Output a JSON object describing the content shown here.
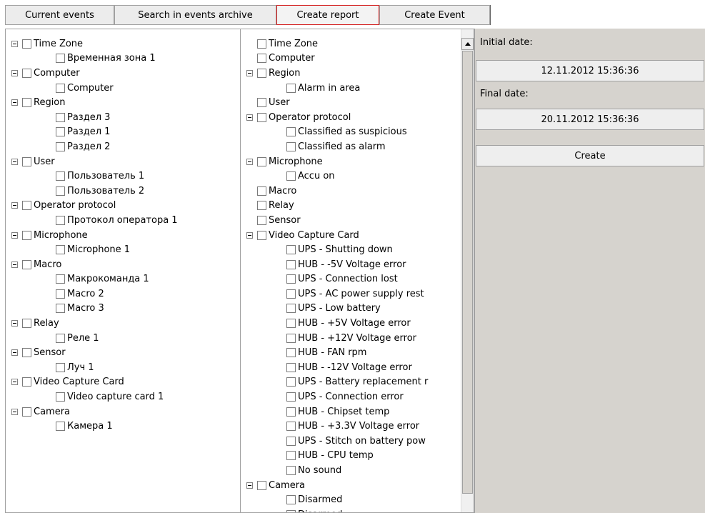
{
  "tabs": [
    {
      "label": "Current events"
    },
    {
      "label": "Search in events archive"
    },
    {
      "label": "Create report"
    },
    {
      "label": "Create Event"
    }
  ],
  "left_tree": [
    {
      "label": "Time Zone",
      "level": 0
    },
    {
      "label": "Временная зона 1",
      "level": 1
    },
    {
      "label": "Computer",
      "level": 0
    },
    {
      "label": "Computer",
      "level": 1
    },
    {
      "label": "Region",
      "level": 0
    },
    {
      "label": "Раздел 3",
      "level": 1
    },
    {
      "label": "Раздел 1",
      "level": 1
    },
    {
      "label": "Раздел 2",
      "level": 1
    },
    {
      "label": "User",
      "level": 0
    },
    {
      "label": "Пользователь 1",
      "level": 1
    },
    {
      "label": "Пользователь 2",
      "level": 1
    },
    {
      "label": "Operator protocol",
      "level": 0
    },
    {
      "label": "Протокол оператора 1",
      "level": 1
    },
    {
      "label": "Microphone",
      "level": 0
    },
    {
      "label": "Microphone 1",
      "level": 1
    },
    {
      "label": "Macro",
      "level": 0
    },
    {
      "label": "Макрокоманда 1",
      "level": 1
    },
    {
      "label": "Macro 2",
      "level": 1
    },
    {
      "label": "Macro 3",
      "level": 1
    },
    {
      "label": "Relay",
      "level": 0
    },
    {
      "label": "Реле 1",
      "level": 1
    },
    {
      "label": "Sensor",
      "level": 0
    },
    {
      "label": "Луч 1",
      "level": 1
    },
    {
      "label": "Video Capture Card",
      "level": 0
    },
    {
      "label": "Video capture card 1",
      "level": 1
    },
    {
      "label": "Camera",
      "level": 0
    },
    {
      "label": "Камера 1",
      "level": 1
    }
  ],
  "middle_tree": [
    {
      "label": "Time Zone",
      "level": 0,
      "expandable": false
    },
    {
      "label": "Computer",
      "level": 0,
      "expandable": false
    },
    {
      "label": "Region",
      "level": 0,
      "expandable": true
    },
    {
      "label": "Alarm in area",
      "level": 1
    },
    {
      "label": "User",
      "level": 0,
      "expandable": false
    },
    {
      "label": "Operator protocol",
      "level": 0,
      "expandable": true
    },
    {
      "label": "Classified as suspicious",
      "level": 1
    },
    {
      "label": "Classified as alarm",
      "level": 1
    },
    {
      "label": "Microphone",
      "level": 0,
      "expandable": true
    },
    {
      "label": "Accu on",
      "level": 1
    },
    {
      "label": "Macro",
      "level": 0,
      "expandable": false
    },
    {
      "label": "Relay",
      "level": 0,
      "expandable": false
    },
    {
      "label": "Sensor",
      "level": 0,
      "expandable": false
    },
    {
      "label": "Video Capture Card",
      "level": 0,
      "expandable": true
    },
    {
      "label": "UPS - Shutting down",
      "level": 1
    },
    {
      "label": "HUB - -5V Voltage error",
      "level": 1
    },
    {
      "label": "UPS - Connection lost",
      "level": 1
    },
    {
      "label": "UPS - AC power supply rest",
      "level": 1
    },
    {
      "label": "UPS - Low battery",
      "level": 1
    },
    {
      "label": "HUB - +5V Voltage error",
      "level": 1
    },
    {
      "label": "HUB - +12V Voltage error",
      "level": 1
    },
    {
      "label": "HUB - FAN rpm",
      "level": 1
    },
    {
      "label": "HUB - -12V Voltage error",
      "level": 1
    },
    {
      "label": "UPS - Battery replacement r",
      "level": 1
    },
    {
      "label": "UPS - Connection error",
      "level": 1
    },
    {
      "label": "HUB - Chipset temp",
      "level": 1
    },
    {
      "label": "HUB - +3.3V Voltage error",
      "level": 1
    },
    {
      "label": "UPS - Stitch on battery pow",
      "level": 1
    },
    {
      "label": "HUB - CPU temp",
      "level": 1
    },
    {
      "label": "No sound",
      "level": 1
    },
    {
      "label": "Camera",
      "level": 0,
      "expandable": true
    },
    {
      "label": "Disarmed",
      "level": 1
    },
    {
      "label": "Disarmed",
      "level": 1
    }
  ],
  "report": {
    "initial_label": "Initial date:",
    "initial_value": "12.11.2012 15:36:36",
    "final_label": "Final date:",
    "final_value": "20.11.2012 15:36:36",
    "create_label": "Create"
  }
}
